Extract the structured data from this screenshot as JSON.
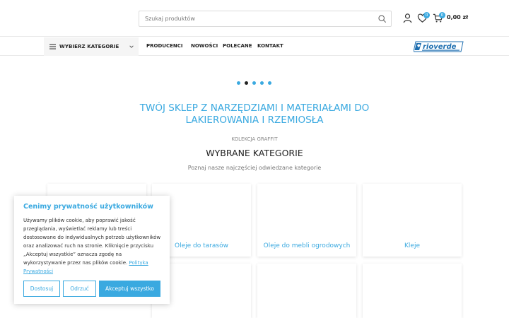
{
  "header": {
    "search_placeholder": "Szukaj produktów",
    "wishlist_count": "0",
    "cart_count": "0",
    "cart_total": "0,00 zł"
  },
  "nav": {
    "categories_label": "WYBIERZ KATEGORIE",
    "items": [
      "PRODUCENCI",
      "NOWOŚCI",
      "POLECANE",
      "KONTAKT"
    ],
    "logo_text": "rioverde"
  },
  "hero": {
    "headline_line1": "TWÓJ SKLEP Z NARZĘDZIAMI I MATERIAŁAMI DO",
    "headline_line2": "LAKIEROWANIA I RZEMIOSŁA"
  },
  "section": {
    "collection": "KOLEKCJA GRAFFIT",
    "title": "WYBRANE KATEGORIE",
    "description": "Poznaj nasze najczęściej odwiedzane kategorie"
  },
  "categories": [
    "",
    "Oleje do tarasów",
    "Oleje do mebli ogrodowych",
    "Kleje"
  ],
  "cookie": {
    "title": "Cenimy prywatność użytkowników",
    "text": "Używamy plików cookie, aby poprawić jakość przeglądania, wyświetlać reklamy lub treści dostosowane do indywidualnych potrzeb użytkowników oraz analizować ruch na stronie. Kliknięcie przycisku „Akceptuj wszystkie” oznacza zgodę na wykorzystywanie przez nas plików cookie.",
    "policy_link": "Polityka Prywatności",
    "btn_reject": "Dostosuj",
    "btn_customize": "Odrzuć",
    "btn_accept": "Akceptuj wszystko"
  },
  "colors": {
    "accent": "#3aa9e0",
    "text": "#222222"
  }
}
